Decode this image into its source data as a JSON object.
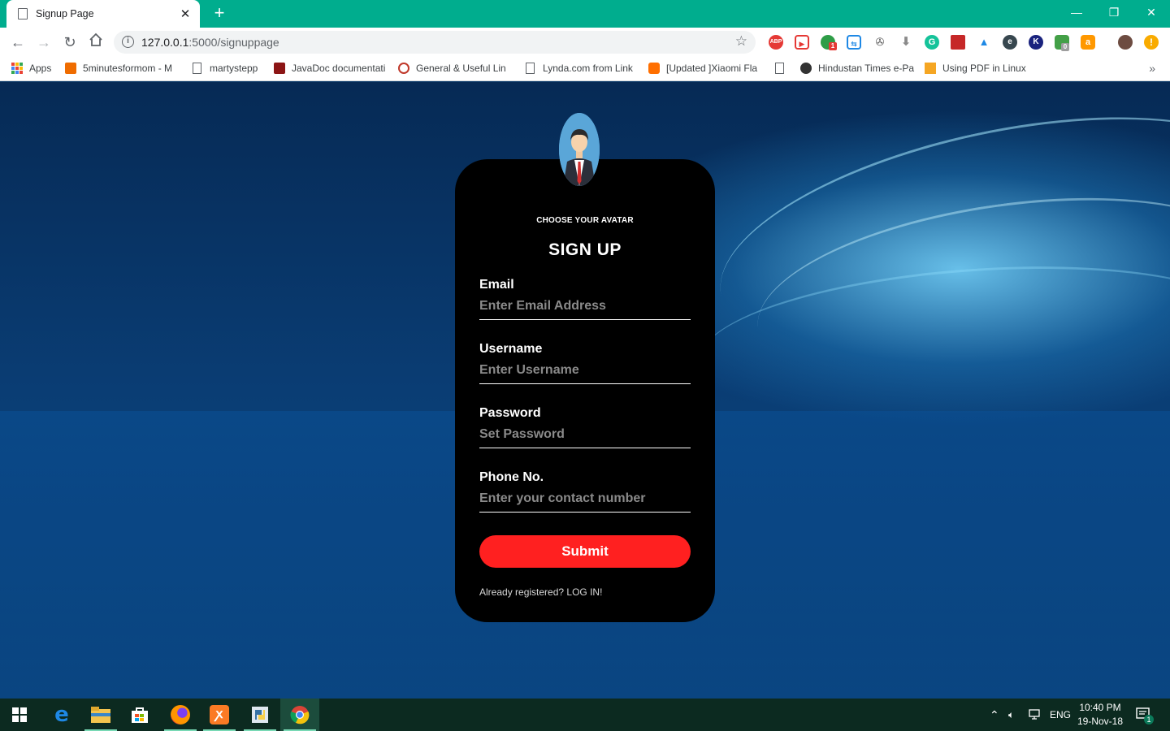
{
  "browser": {
    "tab": {
      "title": "Signup Page"
    },
    "window_controls": {
      "minimize": "—",
      "restore": "❐",
      "close": "✕"
    },
    "url": {
      "host": "127.0.0.1",
      "path": ":5000/signuppage"
    },
    "extension_badges": {
      "ext_one": "1",
      "ext_zero": "0"
    },
    "colors": {
      "tabbar": "#00ad8e"
    }
  },
  "bookmarks": [
    {
      "label": "Apps",
      "icon": "apps-grid-icon"
    },
    {
      "label": "5minutesformom - M",
      "icon": "orange-logo-icon"
    },
    {
      "label": "martystepp",
      "icon": "page-icon"
    },
    {
      "label": "JavaDoc documentati",
      "icon": "stanford-icon"
    },
    {
      "label": "General & Useful Lin",
      "icon": "gear-logo-icon"
    },
    {
      "label": "Lynda.com from Link",
      "icon": "page-icon"
    },
    {
      "label": "[Updated ]Xiaomi Fla",
      "icon": "miui-icon"
    },
    {
      "label": "",
      "icon": "page-icon"
    },
    {
      "label": "Hindustan Times e-Pa",
      "icon": "ht-icon"
    },
    {
      "label": "Using PDF in Linux",
      "icon": "pdf-icon"
    }
  ],
  "signup": {
    "caption": "CHOOSE YOUR AVATAR",
    "title": "SIGN UP",
    "fields": [
      {
        "label": "Email",
        "placeholder": "Enter Email Address"
      },
      {
        "label": "Username",
        "placeholder": "Enter Username"
      },
      {
        "label": "Password",
        "placeholder": "Set Password"
      },
      {
        "label": "Phone No.",
        "placeholder": "Enter your contact number"
      }
    ],
    "submit_label": "Submit",
    "login_prompt": "Already registered? LOG IN!",
    "colors": {
      "card": "#000000",
      "submit": "#ff2020"
    }
  },
  "taskbar": {
    "language": "ENG",
    "time": "10:40 PM",
    "date": "19-Nov-18",
    "notification_count": "1"
  }
}
